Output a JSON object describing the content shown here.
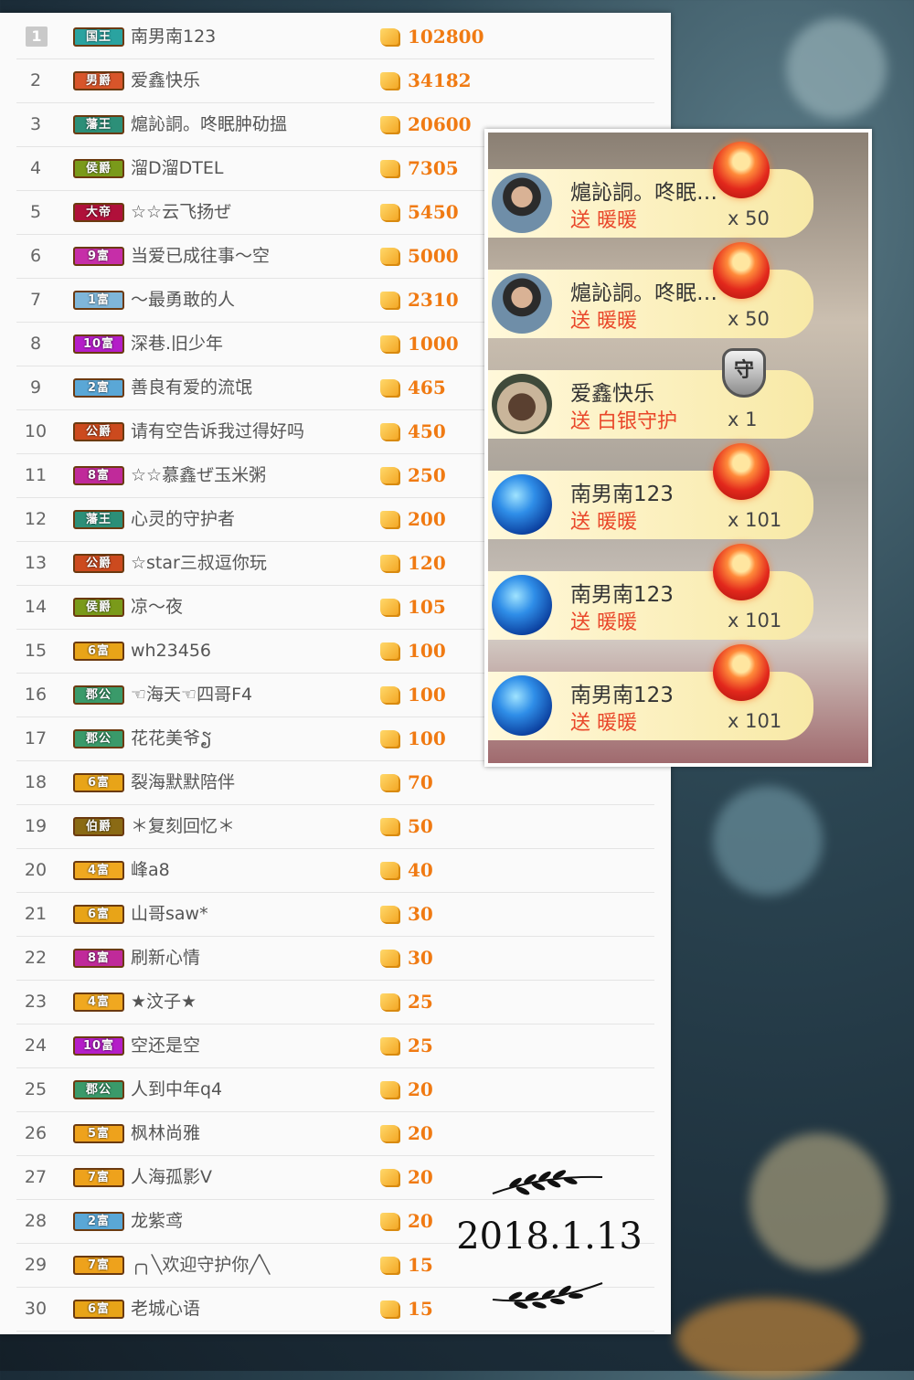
{
  "ranking": [
    {
      "rank": "1",
      "badge": "国王",
      "badge_color": "#2aa3a0",
      "name": "南男南123",
      "amount": "102800"
    },
    {
      "rank": "2",
      "badge": "男爵",
      "badge_color": "#d8552a",
      "name": "爱鑫快乐",
      "amount": "34182"
    },
    {
      "rank": "3",
      "badge": "藩王",
      "badge_color": "#2c8f78",
      "name": "熩訫詷。咚眠肿劯搵",
      "amount": "20600"
    },
    {
      "rank": "4",
      "badge": "侯爵",
      "badge_color": "#7a9a1a",
      "name": "溜D溜DTEL",
      "amount": "7305"
    },
    {
      "rank": "5",
      "badge": "大帝",
      "badge_color": "#b0103a",
      "name": "☆☆云飞扬ぜ",
      "amount": "5450"
    },
    {
      "rank": "6",
      "badge": "9富",
      "badge_color": "#c62ea8",
      "name": "当爱已成往事～空",
      "amount": "5000"
    },
    {
      "rank": "7",
      "badge": "1富",
      "badge_color": "#7fb6d9",
      "name": "～最勇敢的人",
      "amount": "2310"
    },
    {
      "rank": "8",
      "badge": "10富",
      "badge_color": "#b41ec8",
      "name": "深巷.旧少年",
      "amount": "1000"
    },
    {
      "rank": "9",
      "badge": "2富",
      "badge_color": "#5aa7d6",
      "name": "善良有爱的流氓",
      "amount": "465"
    },
    {
      "rank": "10",
      "badge": "公爵",
      "badge_color": "#cc4a1e",
      "name": "请有空告诉我过得好吗",
      "amount": "450"
    },
    {
      "rank": "11",
      "badge": "8富",
      "badge_color": "#c02a9a",
      "name": "☆☆慕鑫ぜ玉米粥",
      "amount": "250"
    },
    {
      "rank": "12",
      "badge": "藩王",
      "badge_color": "#2c8f78",
      "name": "心灵的守护者",
      "amount": "200"
    },
    {
      "rank": "13",
      "badge": "公爵",
      "badge_color": "#cc4a1e",
      "name": "☆star三叔逗你玩",
      "amount": "120"
    },
    {
      "rank": "14",
      "badge": "侯爵",
      "badge_color": "#7a9a1a",
      "name": "凉～夜",
      "amount": "105"
    },
    {
      "rank": "15",
      "badge": "6富",
      "badge_color": "#e8a418",
      "name": "wh23456",
      "amount": "100"
    },
    {
      "rank": "16",
      "badge": "郡公",
      "badge_color": "#3a9a6a",
      "name": "☜海天☜四哥F4",
      "amount": "100"
    },
    {
      "rank": "17",
      "badge": "郡公",
      "badge_color": "#3a9a6a",
      "name": "花花美爷ຽ",
      "amount": "100"
    },
    {
      "rank": "18",
      "badge": "6富",
      "badge_color": "#e8a418",
      "name": "裂海默默陪伴",
      "amount": "70"
    },
    {
      "rank": "19",
      "badge": "伯爵",
      "badge_color": "#8a6a14",
      "name": "＊复刻回忆＊",
      "amount": "50"
    },
    {
      "rank": "20",
      "badge": "4富",
      "badge_color": "#f0a820",
      "name": "峰a8",
      "amount": "40"
    },
    {
      "rank": "21",
      "badge": "6富",
      "badge_color": "#e8a418",
      "name": "山哥saw*",
      "amount": "30"
    },
    {
      "rank": "22",
      "badge": "8富",
      "badge_color": "#c02a9a",
      "name": "刷新心情",
      "amount": "30"
    },
    {
      "rank": "23",
      "badge": "4富",
      "badge_color": "#f0a820",
      "name": "★汶子★",
      "amount": "25"
    },
    {
      "rank": "24",
      "badge": "10富",
      "badge_color": "#b41ec8",
      "name": "空还是空",
      "amount": "25"
    },
    {
      "rank": "25",
      "badge": "郡公",
      "badge_color": "#3a9a6a",
      "name": "人到中年q4",
      "amount": "20"
    },
    {
      "rank": "26",
      "badge": "5富",
      "badge_color": "#eea21c",
      "name": "枫林尚雅",
      "amount": "20"
    },
    {
      "rank": "27",
      "badge": "7富",
      "badge_color": "#eea21c",
      "name": "人海孤影V",
      "amount": "20"
    },
    {
      "rank": "28",
      "badge": "2富",
      "badge_color": "#5aa7d6",
      "name": "龙紫鸢",
      "amount": "20"
    },
    {
      "rank": "29",
      "badge": "7富",
      "badge_color": "#eea21c",
      "name": "╭╮╲欢迎守护你╱╲",
      "amount": "15"
    },
    {
      "rank": "30",
      "badge": "6富",
      "badge_color": "#e8a418",
      "name": "老城心语",
      "amount": "15"
    }
  ],
  "gifts": [
    {
      "name": "熩訫詷。咚眠…",
      "action": "送 暖暖",
      "count": "x 50",
      "avatar": "person-avatar",
      "gift_icon": "candle-icon"
    },
    {
      "name": "熩訫詷。咚眠…",
      "action": "送 暖暖",
      "count": "x 50",
      "avatar": "person-avatar",
      "gift_icon": "candle-icon"
    },
    {
      "name": "爱鑫快乐",
      "action": "送 白银守护",
      "count": "x 1",
      "avatar": "building-avatar",
      "gift_icon": "shield-icon",
      "shield_char": "守"
    },
    {
      "name": "南男南123",
      "action": "送 暖暖",
      "count": "x 101",
      "avatar": "globe-avatar",
      "gift_icon": "candle-icon"
    },
    {
      "name": "南男南123",
      "action": "送 暖暖",
      "count": "x 101",
      "avatar": "globe-avatar",
      "gift_icon": "candle-icon"
    },
    {
      "name": "南男南123",
      "action": "送 暖暖",
      "count": "x 101",
      "avatar": "globe-avatar",
      "gift_icon": "candle-icon"
    }
  ],
  "date": "2018.1.13",
  "colors": {
    "amount": "#f07a12",
    "gift_action": "#e9472a",
    "gift_bg": "#f8e9a6"
  }
}
